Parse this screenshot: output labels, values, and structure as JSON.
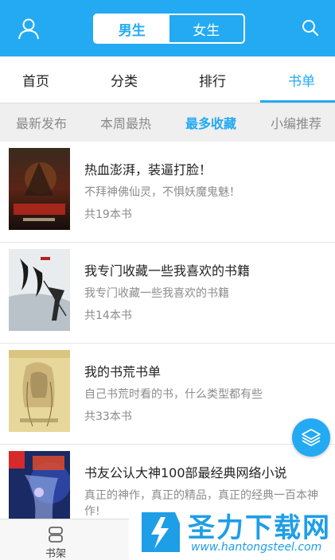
{
  "header": {
    "gender_options": [
      "男生",
      "女生"
    ],
    "selected_gender": "男生",
    "icons": {
      "left": "user-icon",
      "right": "search-icon"
    },
    "accent_color": "#23aaf2"
  },
  "main_tabs": [
    {
      "label": "首页"
    },
    {
      "label": "分类"
    },
    {
      "label": "排行"
    },
    {
      "label": "书单"
    }
  ],
  "active_main_tab": "书单",
  "sub_tabs": [
    {
      "label": "最新发布"
    },
    {
      "label": "本周最热"
    },
    {
      "label": "最多收藏"
    },
    {
      "label": "小编推荐"
    }
  ],
  "active_sub_tab": "最多收藏",
  "book_lists": [
    {
      "title": "热血澎湃，装逼打脸！",
      "desc": "不拜神佛仙灵，不惧妖魔鬼魅！",
      "count": "共19本书",
      "cover": "cover-art-1"
    },
    {
      "title": "我专门收藏一些我喜欢的书籍",
      "desc": "我专门收藏一些我喜欢的书籍",
      "count": "共14本书",
      "cover": "cover-art-2"
    },
    {
      "title": "我的书荒书单",
      "desc": "自己书荒时看的书，什么类型都有些",
      "count": "共33本书",
      "cover": "cover-art-3"
    },
    {
      "title": "书友公认大神100部最经典网络小说",
      "desc": "真正的神作，真正的精品，真正的经典一百本神作!",
      "count": "",
      "cover": "cover-art-4"
    }
  ],
  "fab": {
    "icon": "layers-icon"
  },
  "bottom_nav": {
    "label": "书架",
    "icon": "bookshelf-icon"
  },
  "watermark": {
    "title": "圣力下载网",
    "url": "www.hantongsteel.com"
  }
}
